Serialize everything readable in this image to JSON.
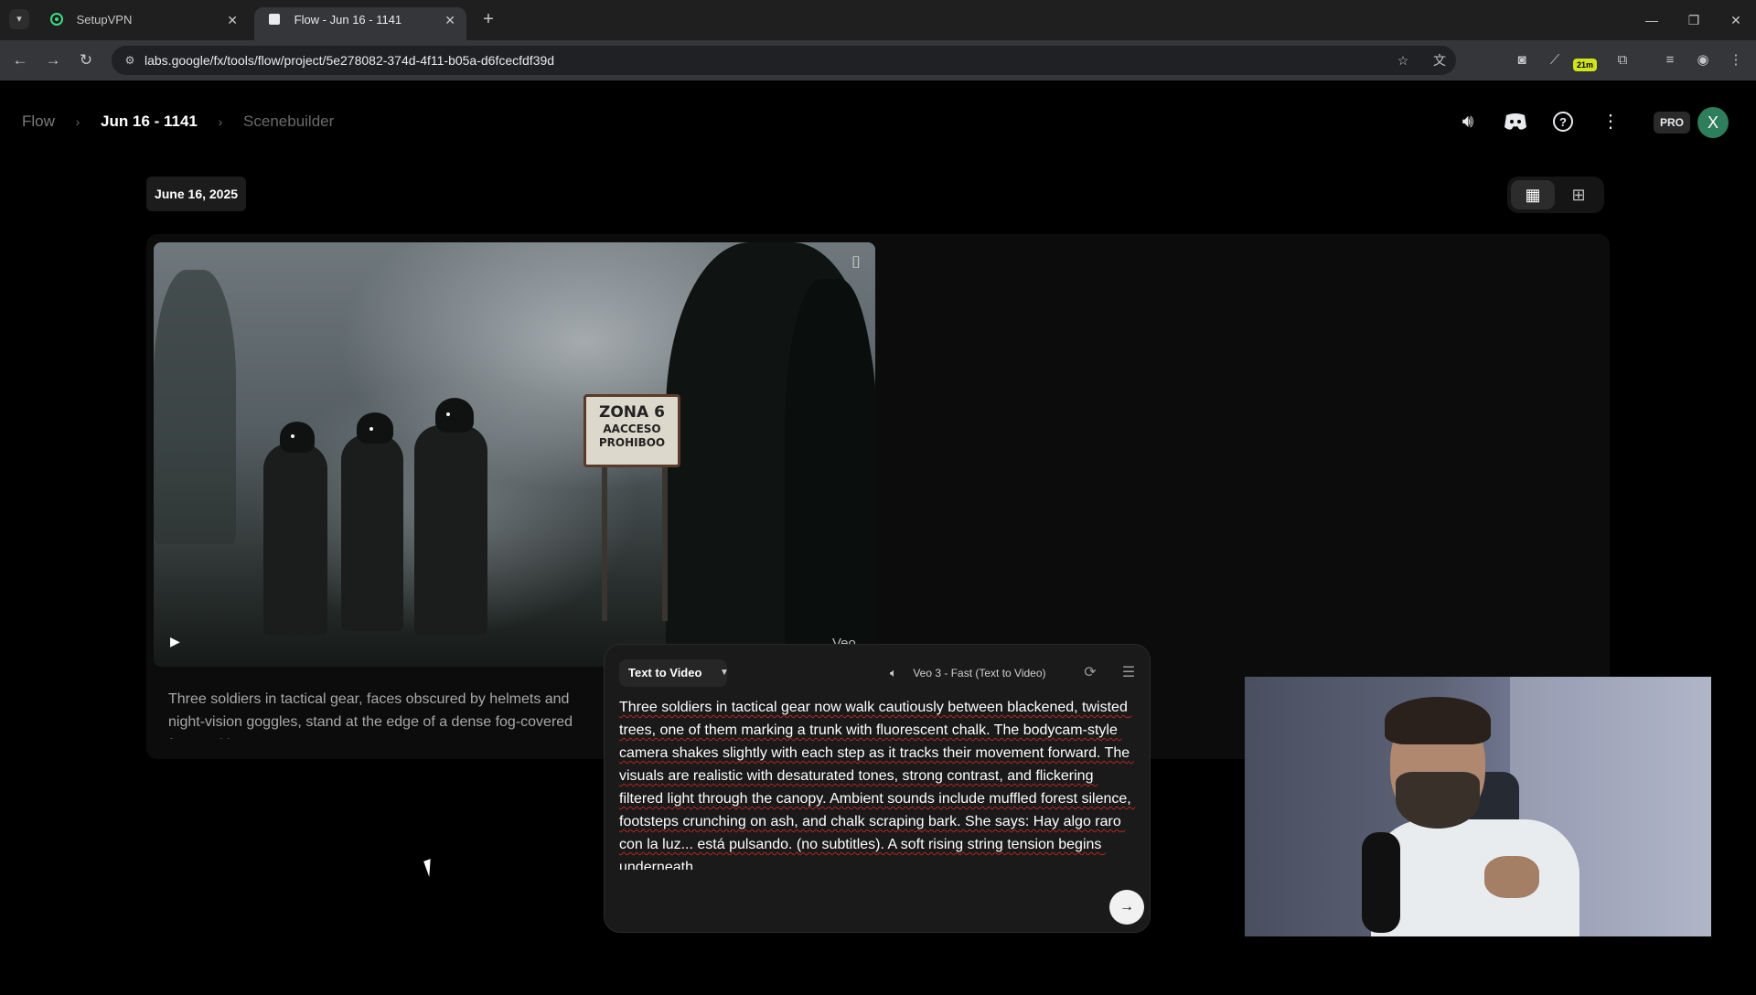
{
  "browser": {
    "tabs": [
      {
        "title": "SetupVPN",
        "active": false
      },
      {
        "title": "Flow - Jun 16 - 1141",
        "active": true
      }
    ],
    "url": "labs.google/fx/tools/flow/project/5e278082-374d-4f11-b05a-d6fcecfdf39d",
    "extension_badge": "21m"
  },
  "header": {
    "breadcrumbs": [
      "Flow",
      "Jun 16 - 1141",
      "Scenebuilder"
    ],
    "pro_label": "PRO",
    "avatar_initial": "X"
  },
  "main": {
    "date": "June 16, 2025",
    "clip": {
      "veo_label": "Veo",
      "sign_line1": "ZONA 6",
      "sign_line2": "AACCESO",
      "sign_line3": "PROHIBOO",
      "description": "Three soldiers in tactical gear, faces obscured by helmets and night-vision goggles, stand at the edge of a dense fog-covered forest with a ru"
    }
  },
  "prompt_panel": {
    "mode": "Text to Video",
    "model": "Veo 3 - Fast (Text to Video)",
    "prompt": "Three soldiers in tactical gear now walk cautiously between blackened, twisted trees, one of them marking a trunk with fluorescent chalk. The bodycam-style camera shakes slightly with each step as it tracks their movement forward. The visuals are realistic with desaturated tones, strong contrast, and flickering filtered light through the canopy. Ambient sounds include muffled forest silence, footsteps crunching on ash, and chalk scraping bark. She says: Hay algo raro con la luz... está pulsando. (no subtitles). A soft rising string tension begins underneath."
  },
  "colors": {
    "background": "#000000",
    "avatar": "#2e7d5b",
    "badge": "#d0e41d"
  }
}
